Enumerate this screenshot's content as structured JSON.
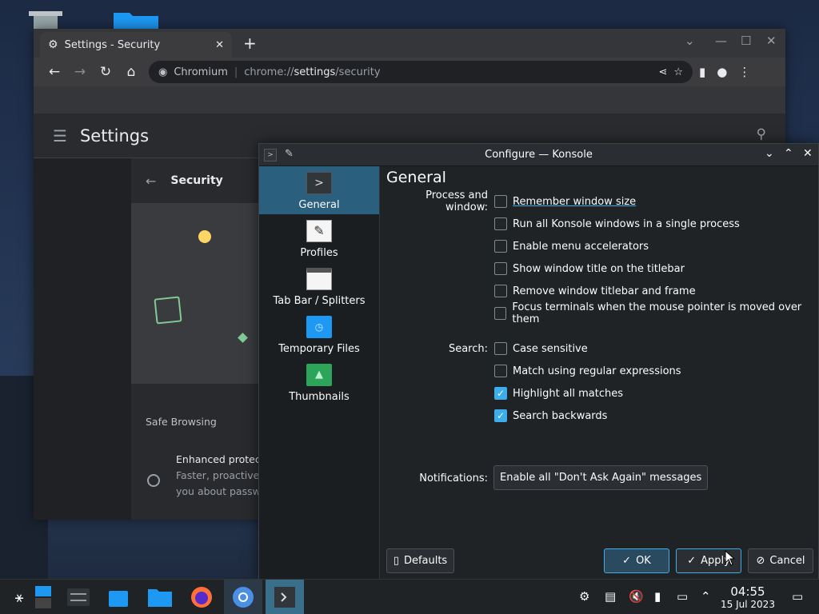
{
  "browser": {
    "tab_title": "Settings - Security",
    "tab_close": "✕",
    "new_tab": "+",
    "site_name": "Chromium",
    "url_scheme": "chrome://",
    "url_host": "settings",
    "url_path": "/security",
    "settings_title": "Settings",
    "security_title": "Security",
    "safe_browsing_label": "Safe Browsing",
    "enhanced_title": "Enhanced protect",
    "enhanced_desc1": "Faster, proactive p",
    "enhanced_desc2": "you about passwo"
  },
  "dialog": {
    "title": "Configure — Konsole",
    "sidebar": [
      {
        "label": "General"
      },
      {
        "label": "Profiles"
      },
      {
        "label": "Tab Bar / Splitters"
      },
      {
        "label": "Temporary Files"
      },
      {
        "label": "Thumbnails"
      }
    ],
    "heading": "General",
    "process_label": "Process and window:",
    "process_options": [
      {
        "label": "Remember window size",
        "checked": false
      },
      {
        "label": "Run all Konsole windows in a single process",
        "checked": false
      },
      {
        "label": "Enable menu accelerators",
        "checked": false
      },
      {
        "label": "Show window title on the titlebar",
        "checked": false
      },
      {
        "label": "Remove window titlebar and frame",
        "checked": false
      },
      {
        "label": "Focus terminals when the mouse pointer is moved over them",
        "checked": false
      }
    ],
    "search_label": "Search:",
    "search_options": [
      {
        "label": "Case sensitive",
        "checked": false
      },
      {
        "label": "Match using regular expressions",
        "checked": false
      },
      {
        "label": "Highlight all matches",
        "checked": true
      },
      {
        "label": "Search backwards",
        "checked": true
      }
    ],
    "notifications_label": "Notifications:",
    "notifications_button": "Enable all \"Don't Ask Again\" messages",
    "defaults_button": "Defaults",
    "ok_button": "OK",
    "apply_button": "Apply",
    "cancel_button": "Cancel"
  },
  "taskbar": {
    "time": "04:55",
    "date": "15 Jul 2023"
  },
  "colors": {
    "accent": "#3daee9",
    "sidebar_active": "#2a5f7e"
  }
}
